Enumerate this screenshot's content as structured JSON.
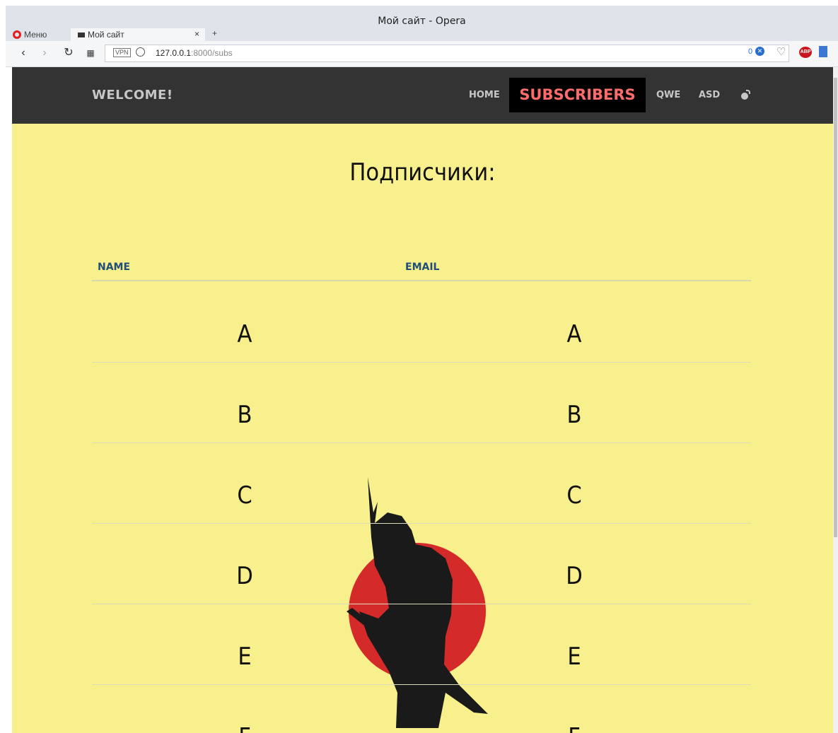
{
  "window": {
    "title": "Мой сайт - Opera"
  },
  "browser": {
    "menu_label": "Меню",
    "tab_title": "Мой сайт",
    "tab_close": "×",
    "new_tab": "+",
    "url_host": "127.0.0.1",
    "url_path": ":8000/subs",
    "vpn_label": "VPN",
    "adblock_count": "0",
    "abp_label": "ABP"
  },
  "site": {
    "brand": "WELCOME!",
    "nav": {
      "home": "HOME",
      "subscribers": "SUBSCRIBERS",
      "qwe": "QWE",
      "asd": "ASD"
    },
    "active_color": "#ff6a6a"
  },
  "main": {
    "title": "Подписчики:",
    "table": {
      "headers": {
        "name": "NAME",
        "email": "EMAIL"
      },
      "rows": [
        {
          "name": "A",
          "email": "A"
        },
        {
          "name": "B",
          "email": "B"
        },
        {
          "name": "C",
          "email": "C"
        },
        {
          "name": "D",
          "email": "D"
        },
        {
          "name": "E",
          "email": "E"
        },
        {
          "name": "F",
          "email": "F"
        }
      ]
    }
  }
}
